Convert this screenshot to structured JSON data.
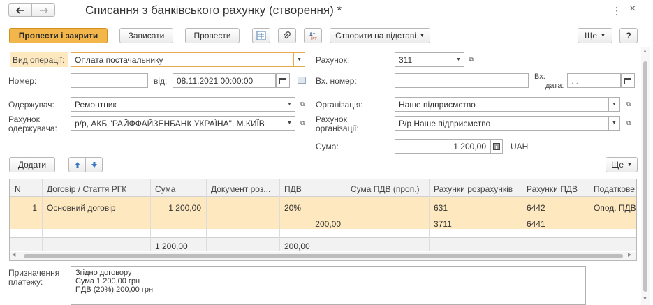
{
  "window": {
    "title": "Списання з банківського рахунку (створення) *",
    "back_icon": "arrow-left",
    "forward_icon": "arrow-right",
    "more_icon": "⋮",
    "close_icon": "×"
  },
  "toolbar": {
    "post_close_label": "Провести і закрити",
    "save_label": "Записати",
    "post_label": "Провести",
    "create_based_label": "Створити на підставі",
    "more_label": "Ще",
    "help_label": "?"
  },
  "form": {
    "operation_label": "Вид операції:",
    "operation_value": "Оплата постачальнику",
    "account_label": "Рахунок:",
    "account_value": "311",
    "number_label": "Номер:",
    "number_value": "",
    "date_from_label": "від:",
    "date_value": "08.11.2021 00:00:00",
    "in_number_label": "Вх. номер:",
    "in_number_value": "",
    "in_date_label_1": "Вх.",
    "in_date_label_2": "дата:",
    "in_date_value": " .  .",
    "recipient_label": "Одержувач:",
    "recipient_value": "Ремонтник",
    "organization_label": "Організація:",
    "organization_value": "Наше підприємство",
    "recipient_account_label_1": "Рахунок",
    "recipient_account_label_2": "одержувача:",
    "recipient_account_value": "р/р, АКБ \"РАЙФФАЙЗЕНБАНК УКРАЇНА\", М.КИЇВ",
    "org_account_label_1": "Рахунок",
    "org_account_label_2": "організації:",
    "org_account_value": "Р/р Наше підприємство",
    "sum_label": "Сума:",
    "sum_value": "1 200,00",
    "currency": "UAH"
  },
  "table_toolbar": {
    "add_label": "Додати",
    "more_label": "Ще"
  },
  "table": {
    "columns": [
      "N",
      "Договір / Стаття РГК",
      "Сума",
      "Документ роз...",
      "ПДВ",
      "Сума ПДВ (проп.)",
      "Рахунки розрахунків",
      "Рахунки ПДВ",
      "Податкове"
    ],
    "row": {
      "n": "1",
      "contract": "Основний договір",
      "sum": "1 200,00",
      "document": "",
      "vat_rate": "20%",
      "vat_sum": "200,00",
      "settlement_account_1": "631",
      "settlement_account_2": "3711",
      "vat_account_1": "6442",
      "vat_account_2": "6441",
      "tax": "Опод. ПДВ"
    },
    "totals": {
      "sum": "1 200,00",
      "vat": "200,00"
    }
  },
  "purpose": {
    "label_1": "Призначення",
    "label_2": "платежу:",
    "line_1": "Згідно договору",
    "line_2": "Сума 1 200,00 грн",
    "line_3": "ПДВ (20%) 200,00 грн"
  }
}
